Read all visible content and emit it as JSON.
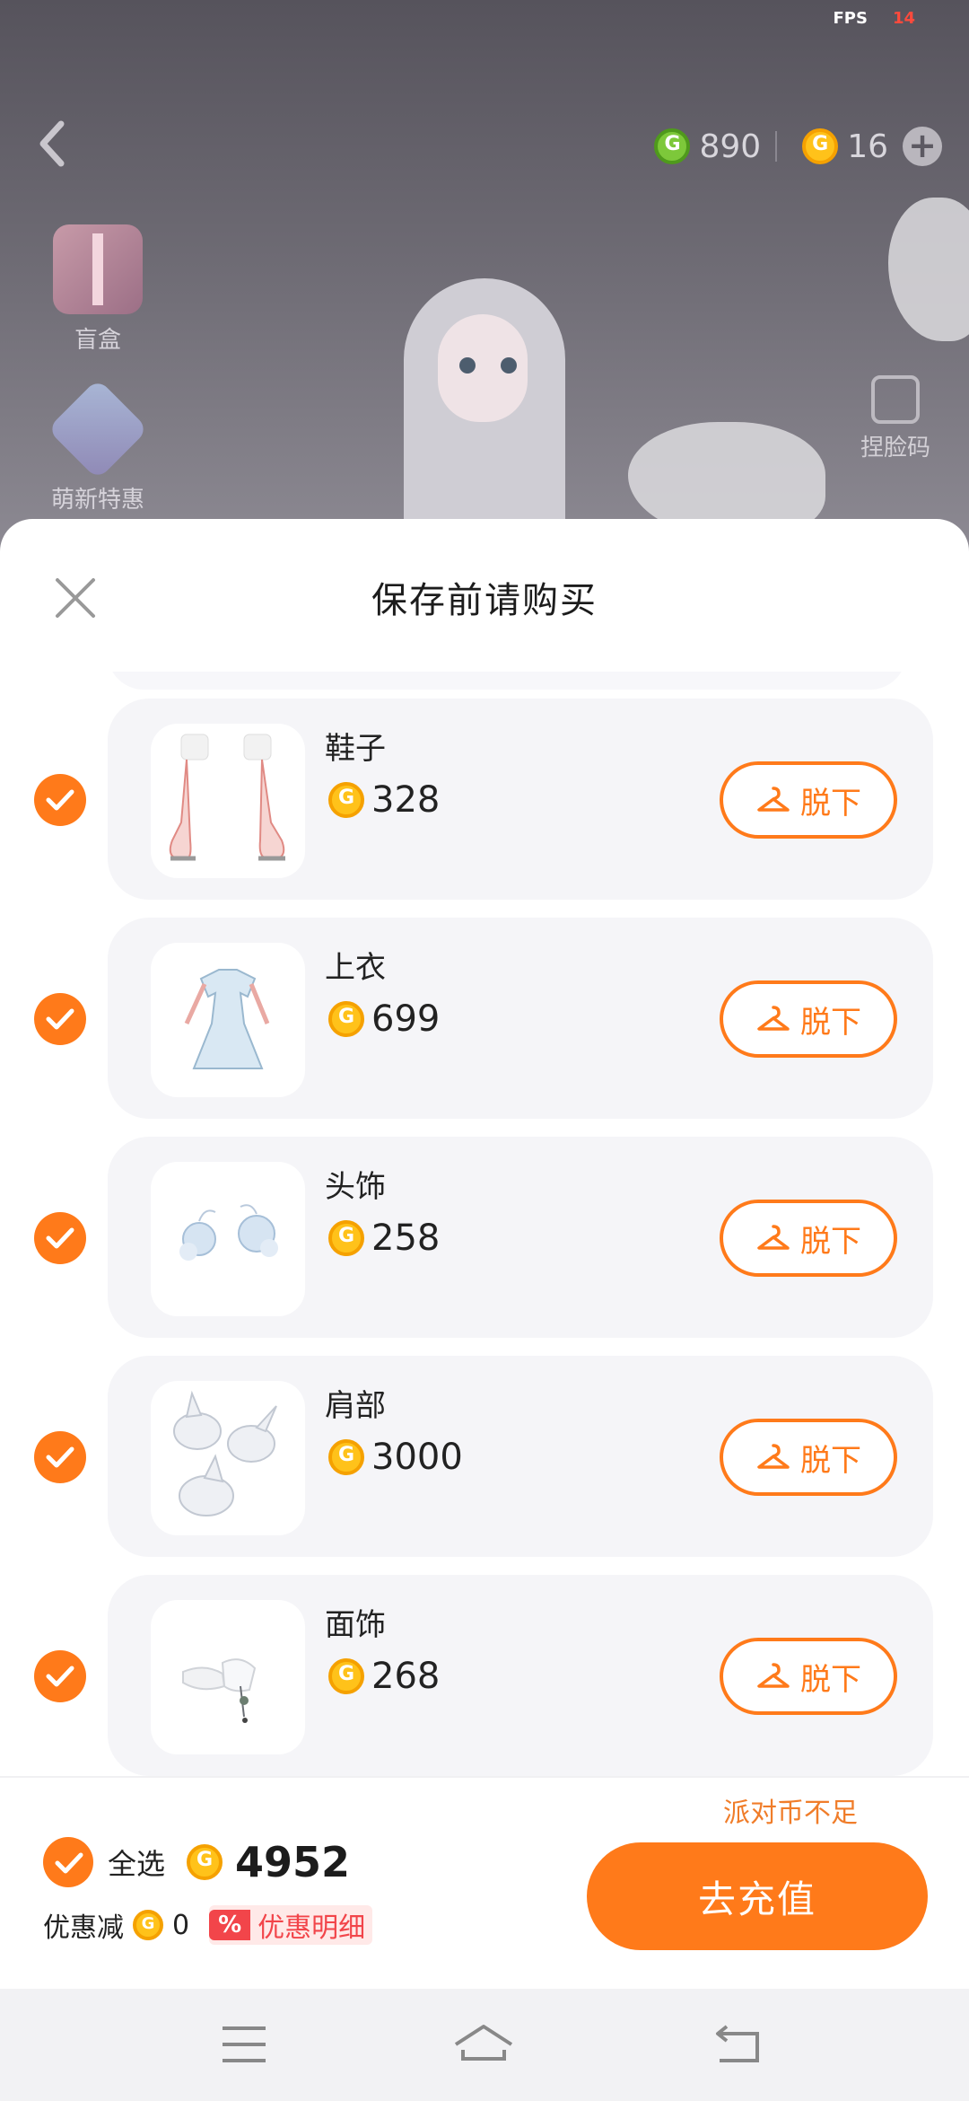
{
  "status": {
    "fps_label": "FPS",
    "fps_value": "14"
  },
  "topbar": {
    "currency_green": "890",
    "currency_gold": "16"
  },
  "side_left": [
    {
      "label": "盲盒",
      "icon": "gift-box-icon"
    },
    {
      "label": "萌新特惠",
      "icon": "newbie-offer-icon"
    }
  ],
  "side_right": [
    {
      "label": "捏脸码",
      "icon": "face-code-icon"
    }
  ],
  "sheet": {
    "title": "保存前请购买",
    "items": [
      {
        "name": "鞋子",
        "price": "328",
        "button": "脱下",
        "checked": true
      },
      {
        "name": "上衣",
        "price": "699",
        "button": "脱下",
        "checked": true
      },
      {
        "name": "头饰",
        "price": "258",
        "button": "脱下",
        "checked": true
      },
      {
        "name": "肩部",
        "price": "3000",
        "button": "脱下",
        "checked": true
      },
      {
        "name": "面饰",
        "price": "268",
        "button": "脱下",
        "checked": true
      }
    ]
  },
  "footer": {
    "insufficient_notice": "派对币不足",
    "select_all_label": "全选",
    "total": "4952",
    "discount_label": "优惠减",
    "discount_value": "0",
    "discount_detail_badge": "%",
    "discount_detail_label": "优惠明细",
    "recharge_label": "去充值"
  },
  "colors": {
    "accent": "#ff7a1a",
    "coin_gold": "#ffc21a",
    "coin_green": "#7dc83a",
    "discount_red": "#f2454a"
  }
}
